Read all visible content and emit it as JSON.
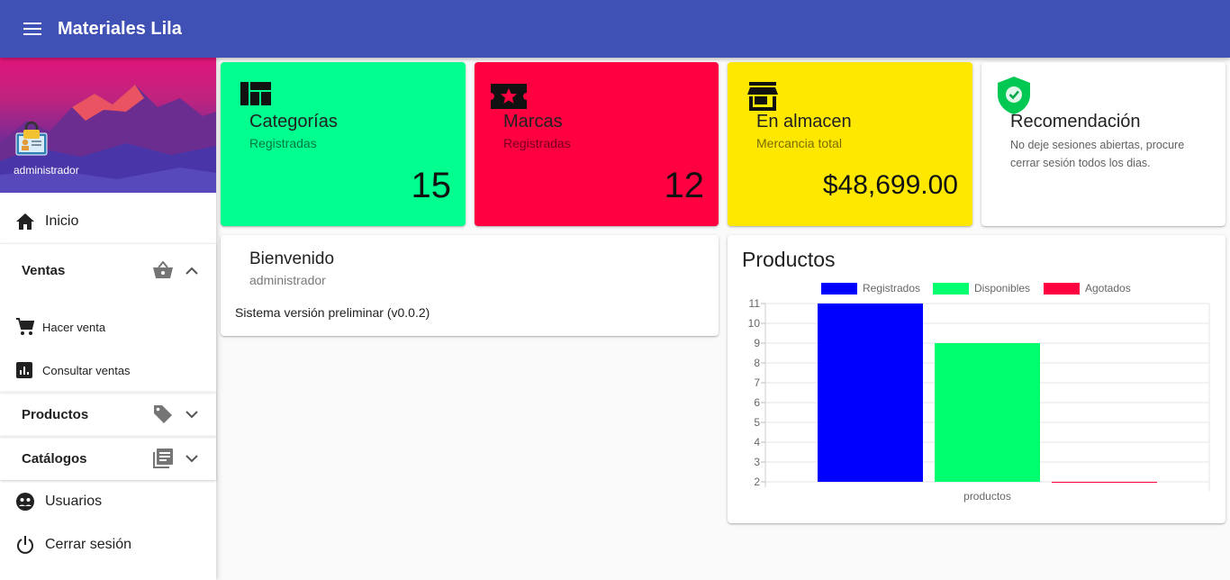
{
  "app": {
    "title": "Materiales Lila"
  },
  "user": {
    "name": "administrador"
  },
  "nav": {
    "inicio": "Inicio",
    "ventas": "Ventas",
    "hacer_venta": "Hacer venta",
    "consultar_ventas": "Consultar ventas",
    "productos": "Productos",
    "catalogos": "Catálogos",
    "usuarios": "Usuarios",
    "cerrar_sesion": "Cerrar sesión"
  },
  "cards": {
    "categorias": {
      "title": "Categorías",
      "subtitle": "Registradas",
      "value": "15",
      "color": "#00ff8e"
    },
    "marcas": {
      "title": "Marcas",
      "subtitle": "Registradas",
      "value": "12",
      "color": "#ff0040"
    },
    "almacen": {
      "title": "En almacen",
      "subtitle": "Mercancia total",
      "value": "$48,699.00",
      "color": "#ffe800"
    },
    "recomendacion": {
      "title": "Recomendación",
      "text": "No deje sesiones abiertas, procure cerrar sesión todos los dias."
    }
  },
  "welcome": {
    "title": "Bienvenido",
    "user": "administrador",
    "version": "Sistema versión preliminar (v0.0.2)"
  },
  "productos_card": {
    "title": "Productos"
  },
  "chart_data": {
    "type": "bar",
    "categories": [
      "productos"
    ],
    "series": [
      {
        "name": "Registrados",
        "values": [
          11
        ],
        "color": "#0000ff"
      },
      {
        "name": "Disponibles",
        "values": [
          9
        ],
        "color": "#00ff6e"
      },
      {
        "name": "Agotados",
        "values": [
          2
        ],
        "color": "#ff0040"
      }
    ],
    "ylim": [
      2,
      11
    ],
    "yticks": [
      "2",
      "3",
      "4",
      "5",
      "6",
      "7",
      "8",
      "9",
      "10",
      "11"
    ],
    "legend": "top",
    "grid": true
  }
}
